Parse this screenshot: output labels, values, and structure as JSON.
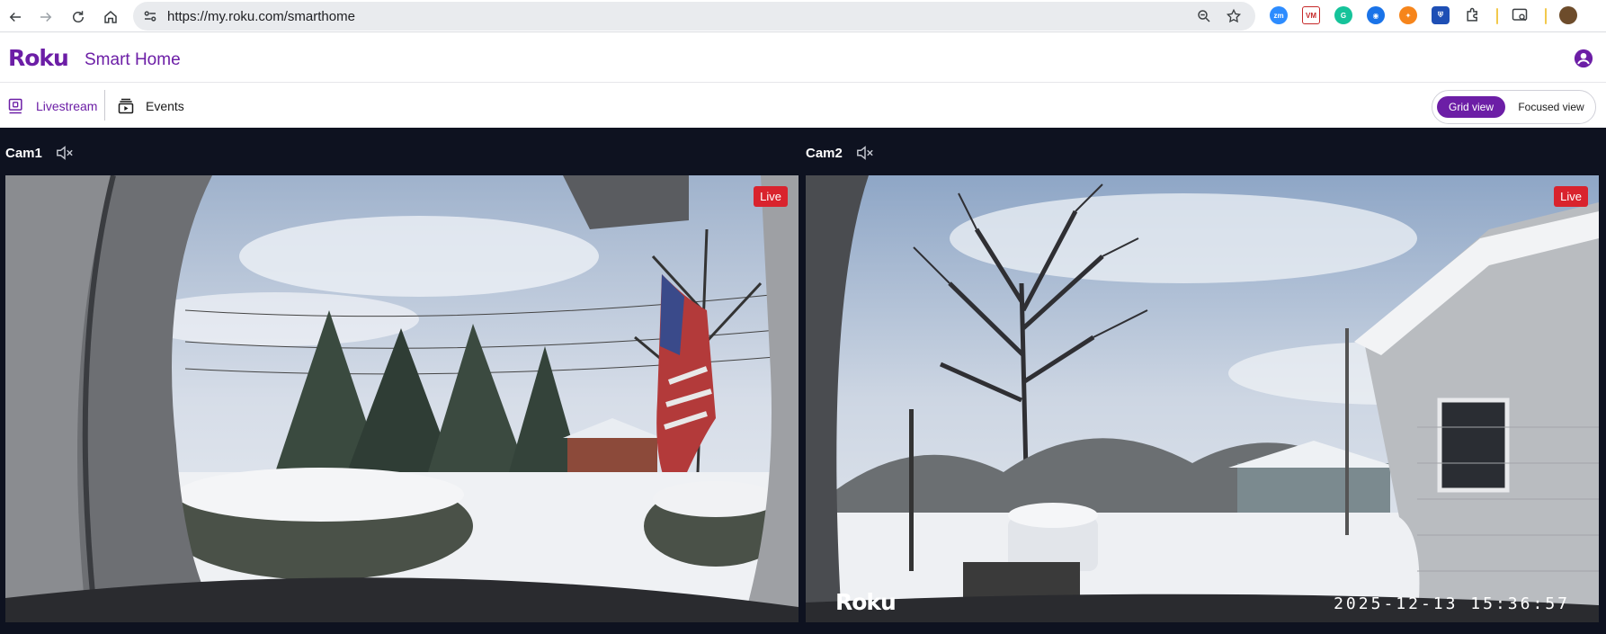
{
  "browser": {
    "url": "https://my.roku.com/smarthome",
    "extensions": [
      "zoom-extension-icon",
      "vm-extension-icon",
      "grammarly-extension-icon",
      "target-extension-icon",
      "metamask-extension-icon",
      "shield-extension-icon",
      "puzzle-extensions-icon"
    ]
  },
  "app": {
    "logo": "Roku",
    "title": "Smart Home"
  },
  "tabs": {
    "livestream": "Livestream",
    "events": "Events"
  },
  "view_toggle": {
    "grid": "Grid view",
    "focused": "Focused view",
    "selected": "grid"
  },
  "cameras": [
    {
      "name": "Cam1",
      "badge": "Live"
    },
    {
      "name": "Cam2",
      "badge": "Live",
      "watermark": "Roku",
      "timestamp": "2025-12-13  15:36:57"
    }
  ],
  "colors": {
    "brand": "#6c1ea6",
    "live": "#d9232d",
    "stage_bg": "#0e1220"
  }
}
